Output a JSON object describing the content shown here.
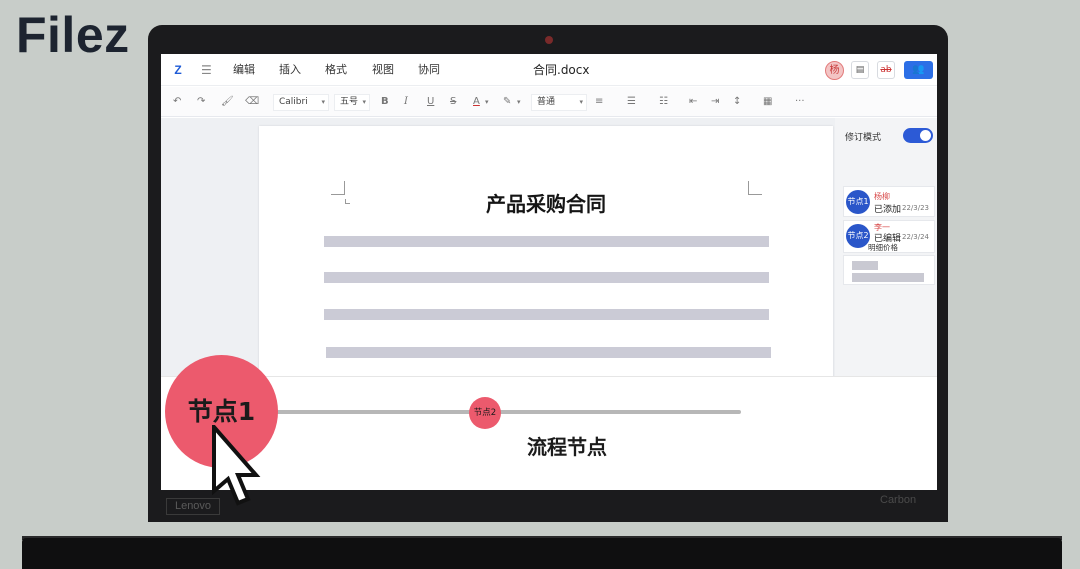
{
  "brand": {
    "logo": "Filez"
  },
  "laptop": {
    "brand_left": "Lenovo",
    "brand_right": "Carbon"
  },
  "menubar": {
    "app_icon": "Z",
    "menus": [
      "编辑",
      "插入",
      "格式",
      "视图",
      "协同"
    ],
    "doc_title": "合同.docx",
    "avatar": "杨",
    "buttons": [
      "comment-icon",
      "strike-icon",
      "share-users-icon"
    ]
  },
  "toolbar": {
    "font_name": "Calibri",
    "font_size": "五号",
    "paragraph_style": "普通",
    "bold": "B",
    "italic": "I",
    "underline": "U",
    "strike": "S",
    "font_color": "A",
    "more": "···"
  },
  "document": {
    "title": "产品采购合同"
  },
  "side_panel": {
    "revision_mode_label": "修订模式",
    "revision_mode_on": true,
    "comments": [
      {
        "avatar": "节点1",
        "name": "杨柳",
        "action": "已添加",
        "date": "22/3/23"
      },
      {
        "avatar": "节点2",
        "name": "李一",
        "action": "已编辑",
        "date": "22/3/24",
        "detail": "明细价格"
      }
    ]
  },
  "flow": {
    "node1": "节点1",
    "node2": "节点2",
    "label": "流程节点"
  },
  "colors": {
    "accent": "#2c6fe6",
    "node": "#ec5a6d",
    "bar": "#cbcbd6"
  }
}
